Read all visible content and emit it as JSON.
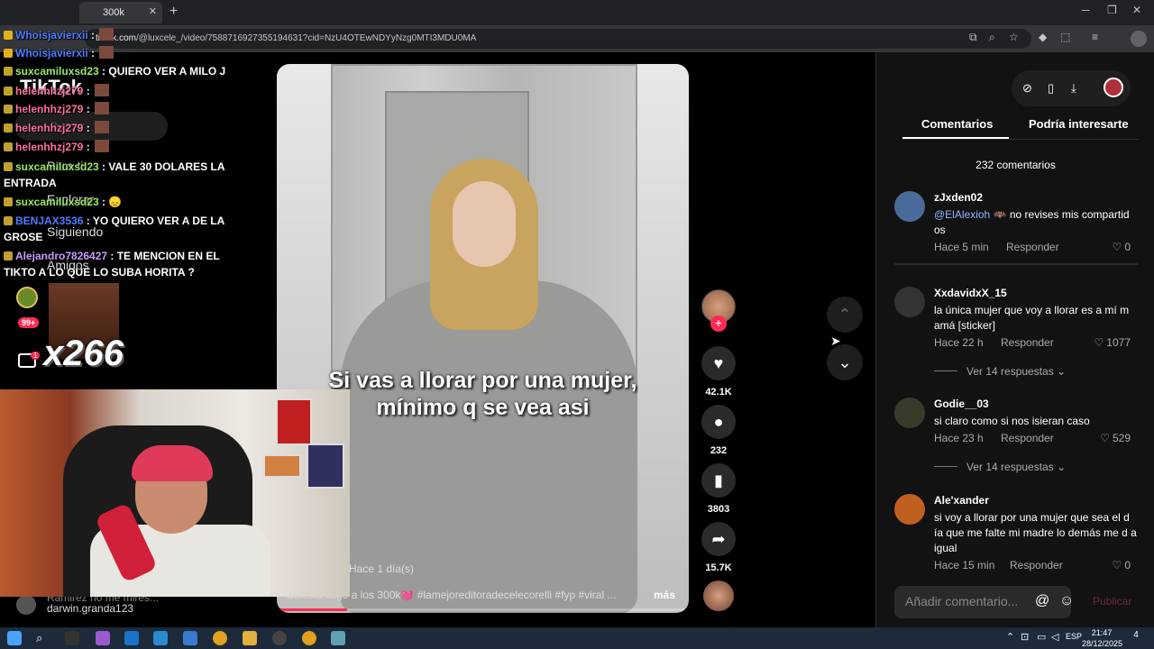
{
  "browser": {
    "tab_title": "300k",
    "url_host": "tiktok.com",
    "url_path": "/@luxcele_/video/7588716927355194631?cid=NzU4OTEwNDYyNzg0MTI3MDU0MA"
  },
  "tiktok_sidebar": {
    "logo": "TikTok",
    "search_placeholder": "Buscar",
    "nav": [
      "Para ti",
      "Explorar",
      "Siguiendo",
      "Amigos"
    ],
    "notifications_badge": "99+",
    "inbox_badge": "1"
  },
  "chat": [
    {
      "user": "Whoisjavierxii",
      "text": " : ",
      "color": "blue",
      "emote": true
    },
    {
      "user": "Whoisjavierxii",
      "text": " : ",
      "color": "blue",
      "emote": true
    },
    {
      "user": "suxcamiluxsd23",
      "text": " : QUIERO VER A MILO J",
      "color": "green",
      "emote": false
    },
    {
      "user": "helenhhzj279",
      "text": " : ",
      "color": "pink",
      "emote": true
    },
    {
      "user": "helenhhzj279",
      "text": " : ",
      "color": "pink",
      "emote": true
    },
    {
      "user": "helenhhzj279",
      "text": " : ",
      "color": "pink",
      "emote": true
    },
    {
      "user": "helenhhzj279",
      "text": " : ",
      "color": "pink",
      "emote": true
    },
    {
      "user": "suxcamiluxsd23",
      "text": " : VALE 30 DOLARES LA ENTRADA",
      "color": "green",
      "emote": false
    },
    {
      "user": "suxcamiluxsd23",
      "text": " : 😞",
      "color": "green",
      "emote": false
    },
    {
      "user": "BENJAX3536",
      "text": " : YO QUIERO VER A DE LA GROSE",
      "color": "blue",
      "emote": false
    },
    {
      "user": "Alejandro7826427",
      "text": " : TE MENCION EN EL TIKTO A LO QUE LO SUBA HORITA ?",
      "color": "purple",
      "emote": false
    }
  ],
  "combo": {
    "count": "x266"
  },
  "below_cam": {
    "line1": "Ramirez no me mires...",
    "line2": "darwin.granda123"
  },
  "video": {
    "caption_line1": "Si vas a llorar por una mujer,",
    "caption_line2": "mínimo q se vea asi",
    "posted": "Hace 1 día(s)",
    "description": "Celesta llegó a los 300k💓 #lamejoreditoradecelecorelli #fyp #viral ...",
    "more": "más",
    "progress": 0.17
  },
  "actions": {
    "follow": "+",
    "likes": "42.1K",
    "comments": "232",
    "saves": "3803",
    "shares": "15.7K"
  },
  "comments_panel": {
    "tab_comments": "Comentarios",
    "tab_interest": "Podría interesarte",
    "count_text": "232 comentarios",
    "comments": [
      {
        "user": "zJxden02",
        "mention": "@ElAlexioh",
        "text": "🦇 no revises mis compartid os",
        "time": "Hace 5 min",
        "reply": "Responder",
        "likes": "0",
        "more": ""
      },
      {
        "user": "XxdavidxX_15",
        "mention": "",
        "text": "la única mujer que voy a llorar es a mí m amá [sticker]",
        "time": "Hace 22 h",
        "reply": "Responder",
        "likes": "1077",
        "more": "Ver 14 respuestas"
      },
      {
        "user": "Godie__03",
        "mention": "",
        "text": "si claro como si nos isieran caso",
        "time": "Hace 23 h",
        "reply": "Responder",
        "likes": "529",
        "more": "Ver 14 respuestas"
      },
      {
        "user": "Ale'xander",
        "mention": "",
        "text": "si voy a llorar por una mujer que sea el d ía que me falte mi madre lo demás me d a igual",
        "time": "Hace 15 min",
        "reply": "Responder",
        "likes": "0",
        "more": ""
      }
    ],
    "input_placeholder": "Añadir comentario...",
    "publish": "Publicar"
  },
  "taskbar": {
    "lang": "ESP",
    "time": "21:47",
    "date": "28/12/2025",
    "notif_count": "4"
  },
  "colors": {
    "accent": "#fe2c55",
    "panel_bg": "#121212",
    "taskbar_bg": "#1c2a3a"
  }
}
